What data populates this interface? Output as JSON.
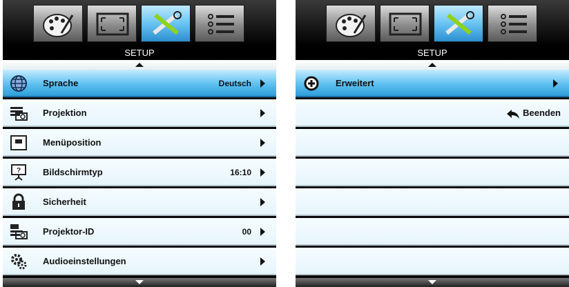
{
  "panels": [
    {
      "title": "SETUP",
      "tabs": [
        "palette-icon",
        "screen-icon",
        "tools-icon",
        "list-icon"
      ],
      "active_tab": 2,
      "rows": [
        {
          "label": "Sprache",
          "value": "Deutsch"
        },
        {
          "label": "Projektion",
          "value": ""
        },
        {
          "label": "Menüposition",
          "value": ""
        },
        {
          "label": "Bildschirmtyp",
          "value": "16:10"
        },
        {
          "label": "Sicherheit",
          "value": ""
        },
        {
          "label": "Projektor-ID",
          "value": "00"
        },
        {
          "label": "Audioeinstellungen",
          "value": ""
        }
      ]
    },
    {
      "title": "SETUP",
      "tabs": [
        "palette-icon",
        "screen-icon",
        "tools-icon",
        "list-icon"
      ],
      "active_tab": 2,
      "rows": [
        {
          "label": "Erweitert",
          "value": ""
        }
      ],
      "exit_label": "Beenden"
    }
  ],
  "colors": {
    "selected_row": "#5ec0f0",
    "active_tab": "#69c4f2",
    "row_background": "#eaf7fd"
  }
}
